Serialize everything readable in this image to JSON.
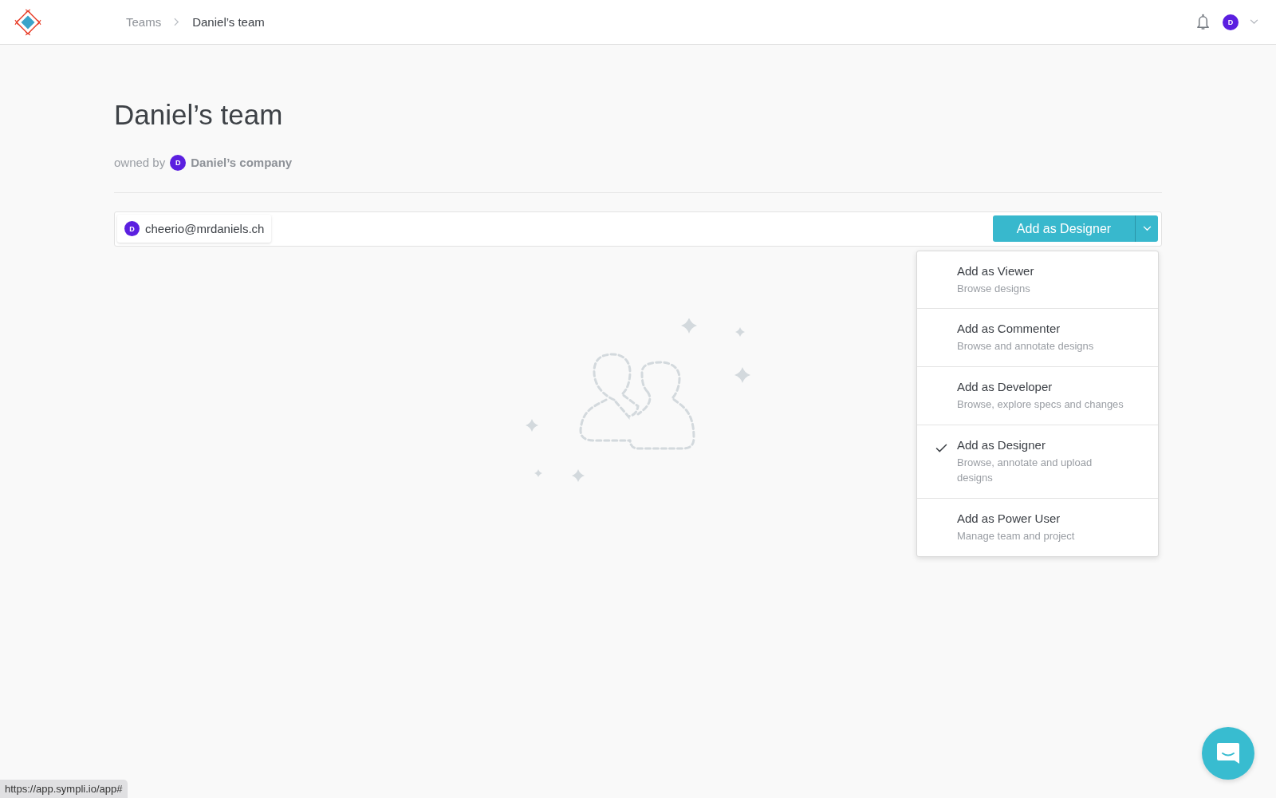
{
  "breadcrumb": [
    {
      "label": "Teams",
      "current": false
    },
    {
      "label": "Daniel’s team",
      "current": true
    }
  ],
  "user_avatar": {
    "initial": "D"
  },
  "page": {
    "title": "Daniel’s team",
    "owned_by_label": "owned by",
    "owner_avatar": "D",
    "owner": "Daniel’s company"
  },
  "invite": {
    "chips": [
      {
        "initial": "D",
        "email": "cheerio@mrdaniels.ch"
      }
    ],
    "button": "Add as Designer"
  },
  "role_menu": [
    {
      "title": "Add as Viewer",
      "description": "Browse designs",
      "selected": false
    },
    {
      "title": "Add as Commenter",
      "description": "Browse and annotate designs",
      "selected": false
    },
    {
      "title": "Add as Developer",
      "description": "Browse, explore specs and changes",
      "selected": false
    },
    {
      "title": "Add as Designer",
      "description": "Browse, annotate and upload designs",
      "selected": true
    },
    {
      "title": "Add as Power User",
      "description": "Manage team and project",
      "selected": false
    }
  ],
  "status_bar": {
    "url": "https://app.sympli.io/app#"
  }
}
